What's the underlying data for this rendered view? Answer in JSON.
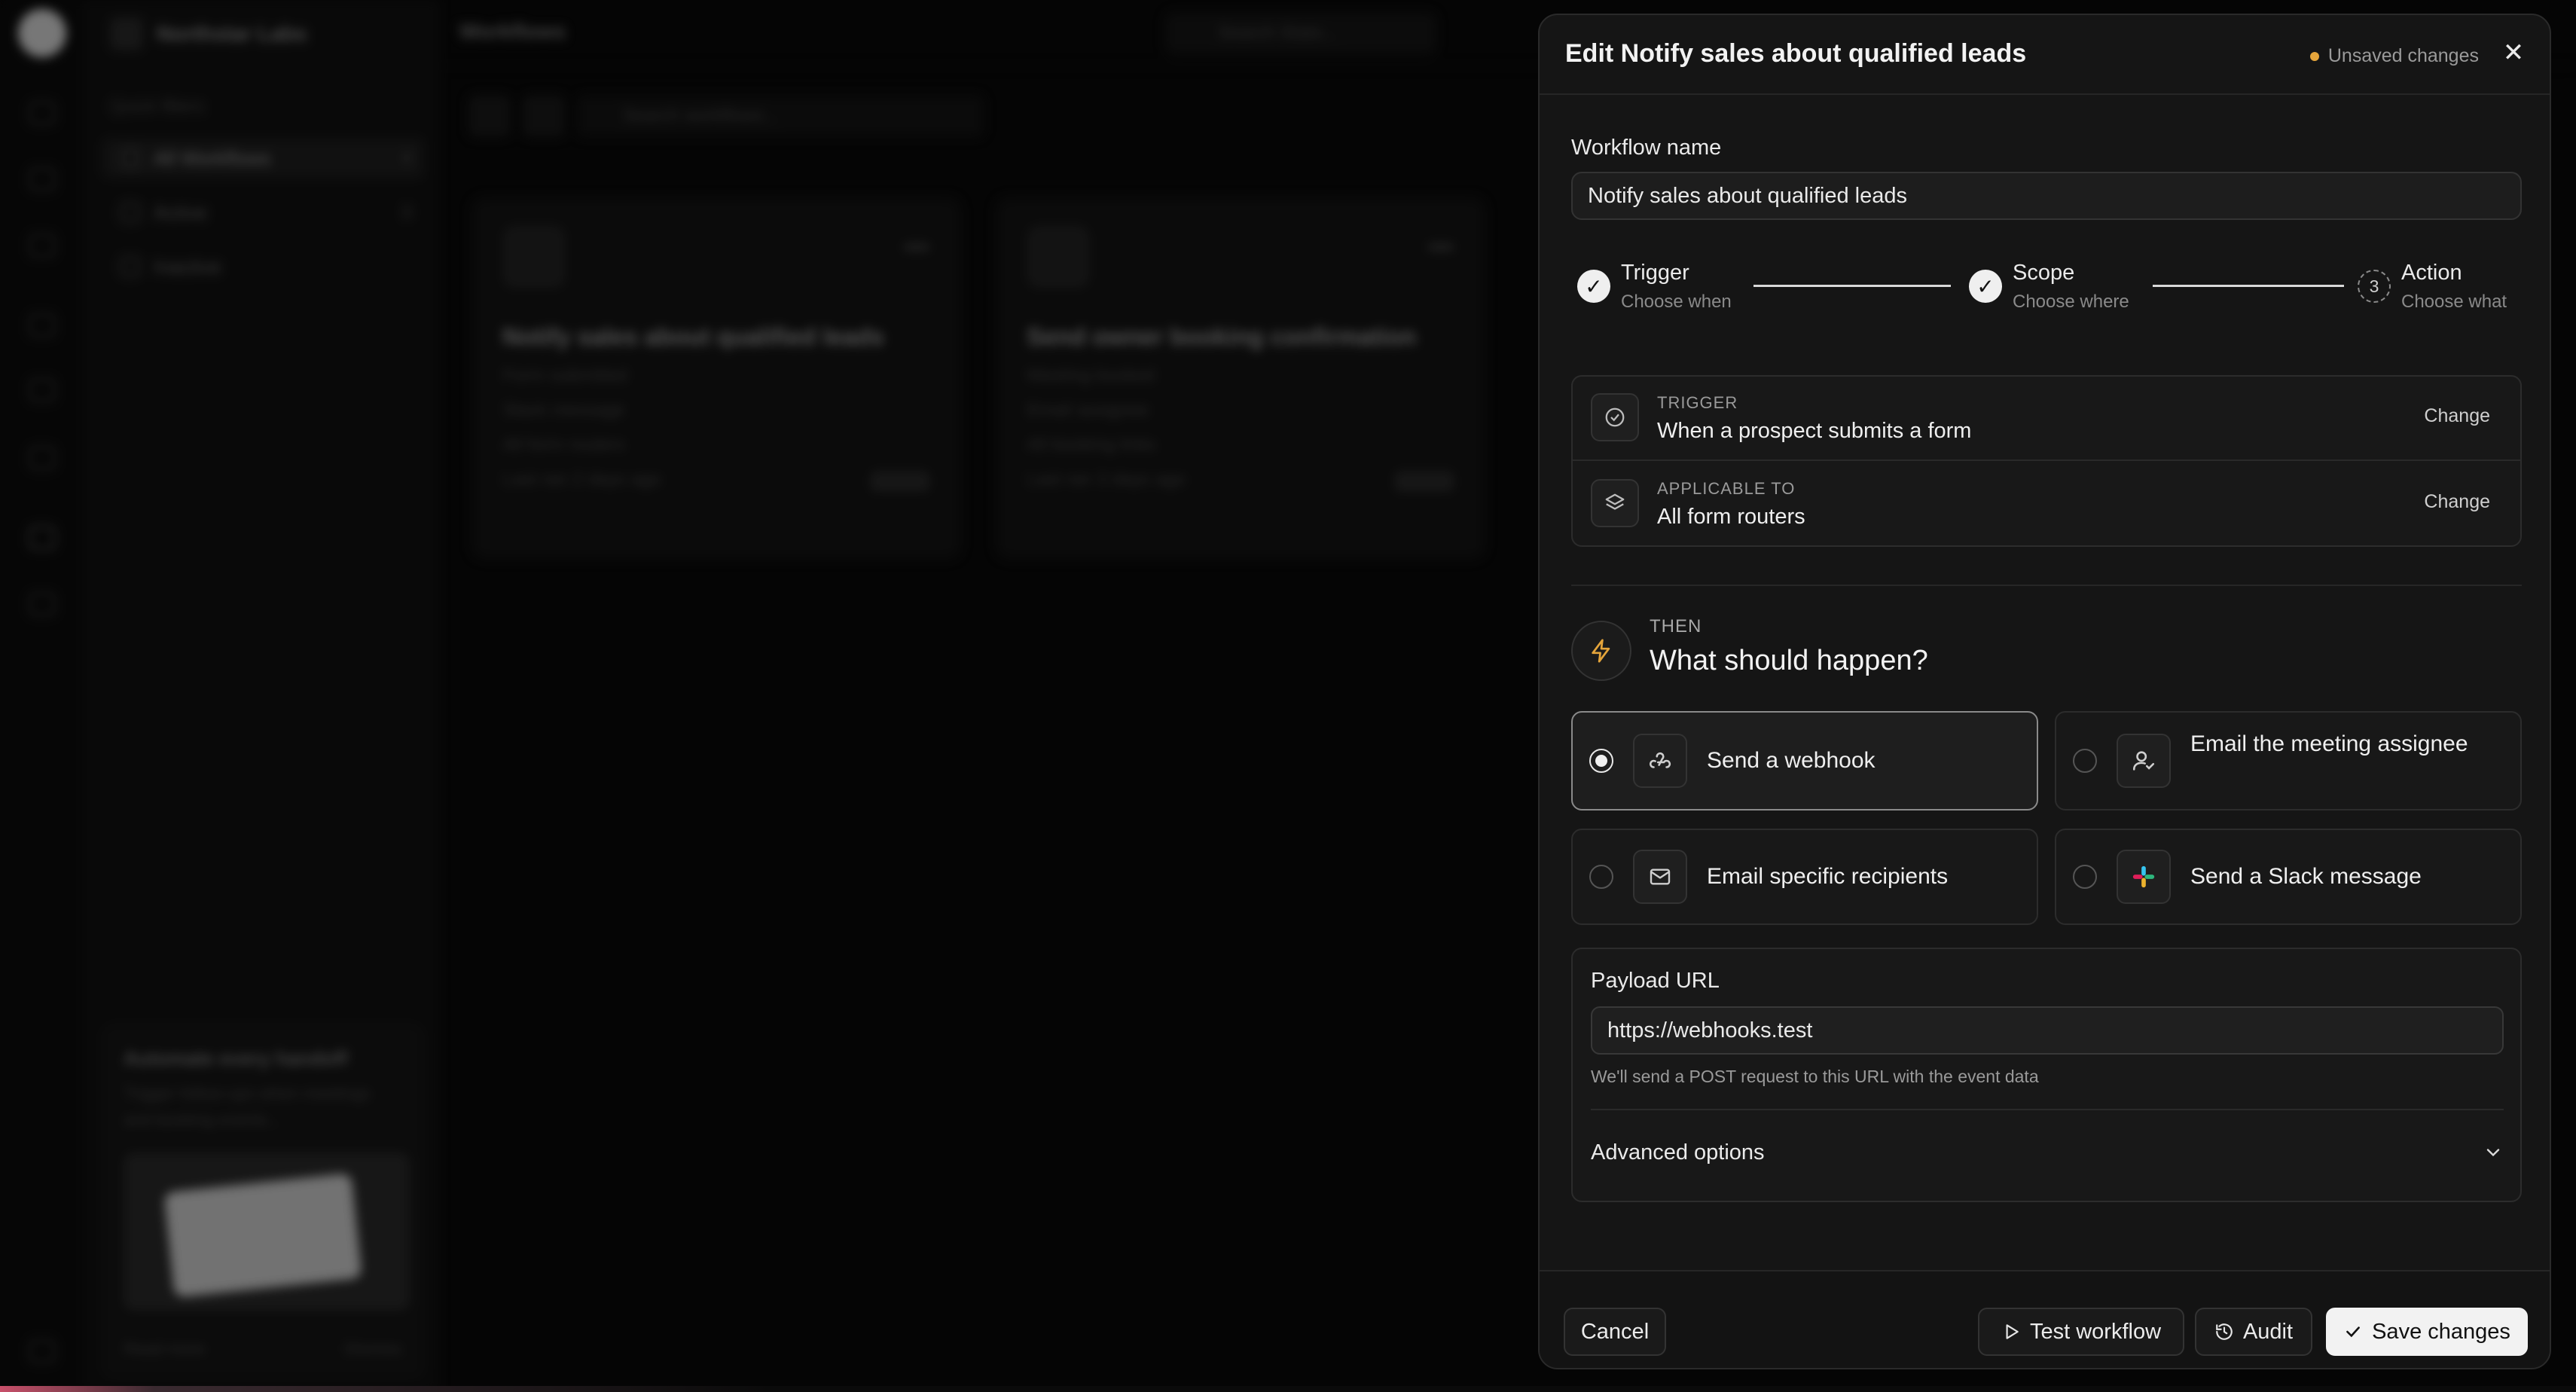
{
  "background": {
    "team_name": "Northstar Labs",
    "page_title": "Workflows",
    "search_placeholder": "Search Stato...",
    "workflow_search_placeholder": "Search workflows...",
    "sidebar": {
      "section_label": "Quick filters",
      "items": [
        {
          "label": "All Workflows",
          "count": "4"
        },
        {
          "label": "Active",
          "count": "3"
        },
        {
          "label": "Inactive",
          "count": ""
        }
      ],
      "promo": {
        "title": "Automate every handoff",
        "subtitle": "Trigger follow-ups when meetings and booking events...",
        "learn_more": "Read more",
        "dismiss": "Dismiss"
      }
    },
    "cards": [
      {
        "title": "Notify sales about qualified leads",
        "lines": [
          "Form submitted",
          "Slack message",
          "All form routers",
          "Last ran 2 days ago"
        ]
      },
      {
        "title": "Send owner booking confirmation",
        "lines": [
          "Meeting booked",
          "Email assignee",
          "All booking links",
          "Last ran 3 days ago"
        ]
      }
    ]
  },
  "panel": {
    "title": "Edit Notify sales about qualified leads",
    "unsaved_label": "Unsaved changes",
    "close_icon": "close-icon",
    "workflow_name_label": "Workflow name",
    "workflow_name_value": "Notify sales about qualified leads",
    "steps": [
      {
        "title": "Trigger",
        "subtitle": "Choose when",
        "state": "done"
      },
      {
        "title": "Scope",
        "subtitle": "Choose where",
        "state": "done"
      },
      {
        "title": "Action",
        "subtitle": "Choose what",
        "state": "current",
        "number": "3"
      }
    ],
    "summary": {
      "trigger": {
        "key": "TRIGGER",
        "value": "When a prospect submits a form",
        "change": "Change",
        "icon": "clock-check-icon"
      },
      "scope": {
        "key": "APPLICABLE TO",
        "value": "All form routers",
        "change": "Change",
        "icon": "layers-icon"
      }
    },
    "then": {
      "key": "THEN",
      "question": "What should happen?",
      "icon": "lightning-icon",
      "accent": "#e5a53b"
    },
    "options": [
      {
        "label": "Send a webhook",
        "icon": "webhook-icon",
        "selected": true
      },
      {
        "label": "Email the meeting assignee",
        "icon": "user-check-icon",
        "selected": false
      },
      {
        "label": "Email specific recipients",
        "icon": "mail-icon",
        "selected": false
      },
      {
        "label": "Send a Slack message",
        "icon": "slack-icon",
        "selected": false
      }
    ],
    "payload": {
      "label": "Payload URL",
      "value": "https://webhooks.test",
      "help": "We'll send a POST request to this URL with the event data",
      "advanced_label": "Advanced options"
    },
    "footer": {
      "cancel": "Cancel",
      "test": "Test workflow",
      "audit": "Audit",
      "save": "Save changes"
    }
  }
}
